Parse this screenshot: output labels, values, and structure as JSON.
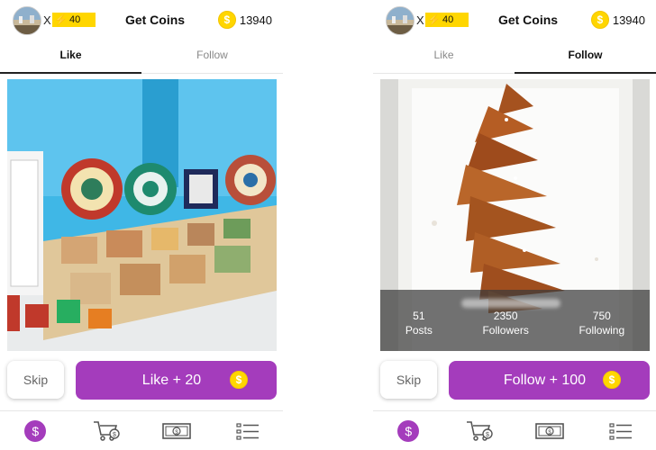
{
  "screens": {
    "left": {
      "header": {
        "close_mark": "X",
        "energy_value": "40",
        "title": "Get Coins",
        "coin_symbol": "$",
        "coins": "13940"
      },
      "tabs": [
        {
          "label": "Like",
          "active": true
        },
        {
          "label": "Follow",
          "active": false
        }
      ],
      "skip_label": "Skip",
      "action_label": "Like + 20",
      "image_description_icon": "moroccan-tiles-photo"
    },
    "right": {
      "header": {
        "close_mark": "X",
        "energy_value": "40",
        "title": "Get Coins",
        "coin_symbol": "$",
        "coins": "13940"
      },
      "tabs": [
        {
          "label": "Like",
          "active": false
        },
        {
          "label": "Follow",
          "active": true
        }
      ],
      "stats": [
        {
          "value": "51",
          "label": "Posts"
        },
        {
          "value": "2350",
          "label": "Followers"
        },
        {
          "value": "750",
          "label": "Following"
        }
      ],
      "skip_label": "Skip",
      "action_label": "Follow + 100",
      "image_description_icon": "pastry-plate-photo"
    }
  },
  "bottom_nav": {
    "items": [
      "coin-dollar-icon",
      "cart-coin-icon",
      "cash-bill-icon",
      "list-icon"
    ],
    "dollar_symbol": "$"
  },
  "colors": {
    "accent": "#a43cbc",
    "coin": "#ffd600",
    "energy": "#ffd600"
  }
}
